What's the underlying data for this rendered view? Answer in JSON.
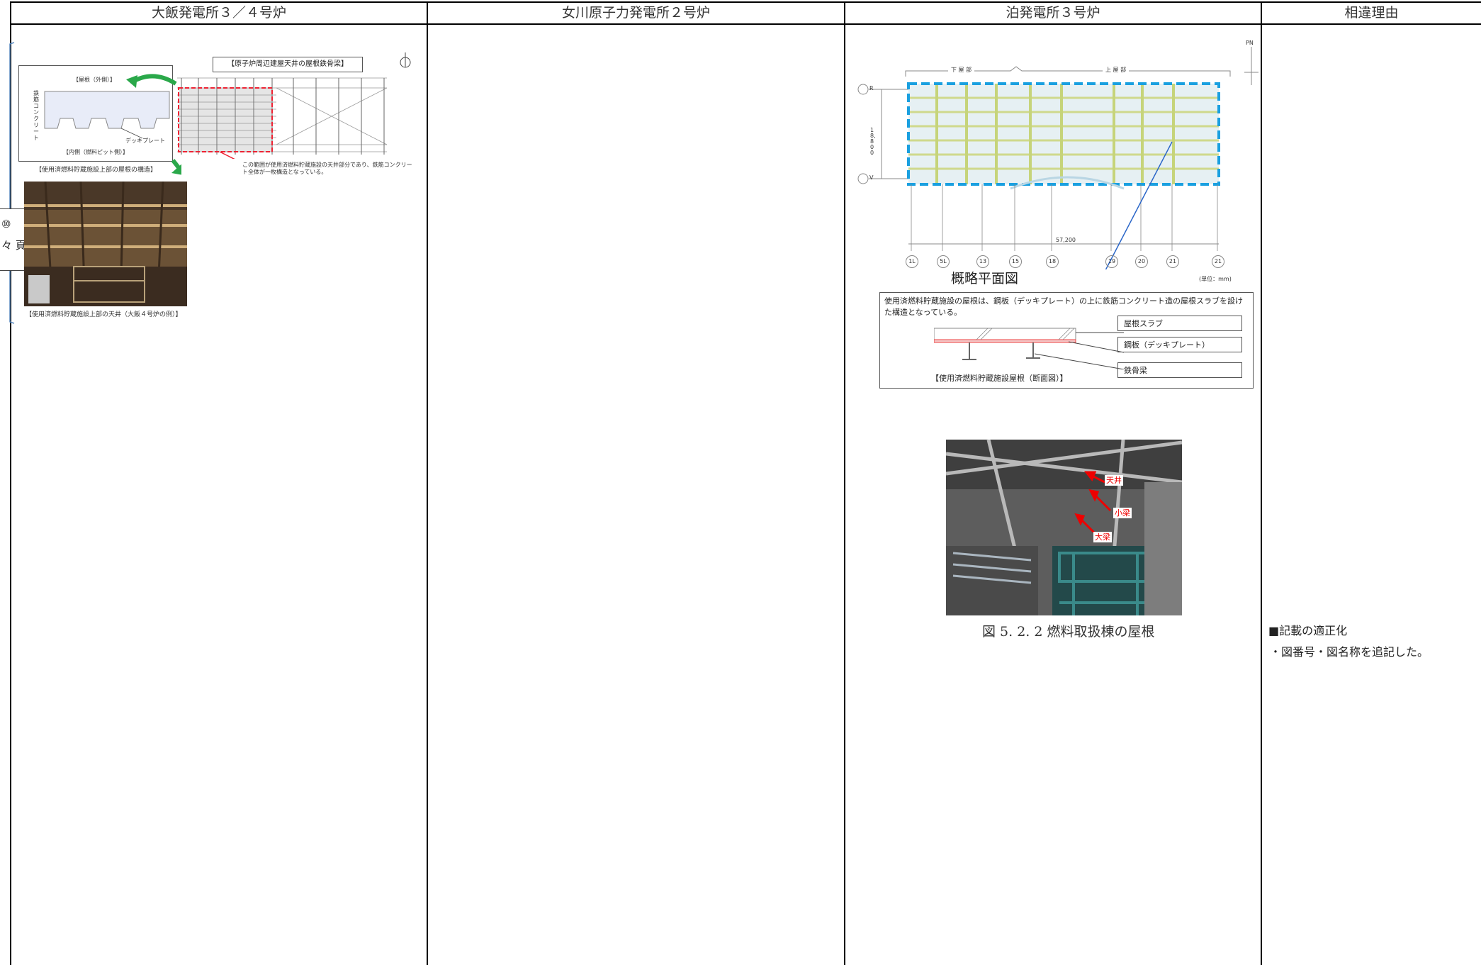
{
  "columns": {
    "ohi": "大飯発電所３／４号炉",
    "onagawa": "女川原子力発電所２号炉",
    "tomari": "泊発電所３号炉",
    "reason": "相違理由"
  },
  "ohi": {
    "beam_title": "【原子炉周辺建屋天井の屋根鉄骨梁】",
    "section_top_label": "【屋根（外側）】",
    "section_side_label": "鉄筋コンクリート",
    "section_deck_label": "デッキプレート",
    "section_bottom_label": "【内側（燃料ピット側）】",
    "section_caption": "【使用済燃料貯蔵施設上部の屋根の構造】",
    "range_note": "この範囲が使用済燃料貯蔵施設の天井部分であり、鉄筋コンクリート全体が一枚構造となっている。",
    "photo_caption": "【使用済燃料貯蔵施設上部の天井（大飯４号炉の例）】",
    "side_tab_line1": "⑩",
    "side_tab_line2": "々 頁"
  },
  "tomari": {
    "plan_title": "概略平面図",
    "plan_unit": "(単位：mm)",
    "plan_left_group": "下 屋 部",
    "plan_right_group": "上 屋 部",
    "plan_dim_vertical": "18,800",
    "plan_dim_horizontal": "57,200",
    "row_labels": [
      "R",
      "V"
    ],
    "col_labels": [
      "1L",
      "5L",
      "13",
      "15",
      "18",
      "19",
      "20",
      "21",
      "21"
    ],
    "north_label": "PN",
    "roof_note": "使用済燃料貯蔵施設の屋根は、鋼板（デッキプレート）の上に鉄筋コンクリート造の屋根スラブを設けた構造となっている。",
    "legend_slab": "屋根スラブ",
    "legend_deck": "鋼板（デッキプレート）",
    "legend_beam": "鉄骨梁",
    "section_caption": "【使用済燃料貯蔵施設屋根（断面図）】",
    "photo_tags": [
      "天井",
      "小梁",
      "大梁"
    ],
    "figure_caption": "図 5. 2. 2 燃料取扱棟の屋根"
  },
  "reason": {
    "heading": "■記載の適正化",
    "detail": "・図番号・図名称を追記した。"
  }
}
